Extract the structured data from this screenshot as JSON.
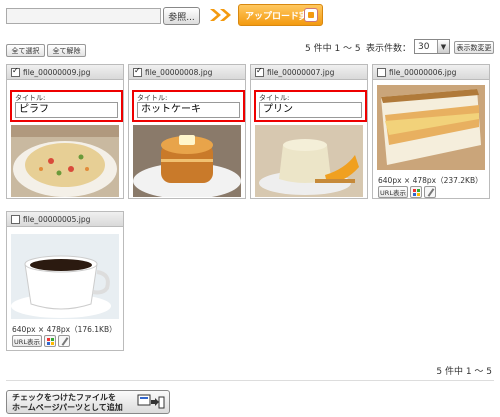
{
  "toolbar": {
    "browse_label": "参照...",
    "upload_label": "アップロード実行"
  },
  "controls": {
    "select_all": "全て選択",
    "deselect_all": "全て解除",
    "count": "5 件中 1 ～ 5",
    "perpage_label": "表示件数：",
    "perpage_value": "30",
    "perpage_button": "表示数変更"
  },
  "cards": [
    {
      "filename": "file_00000009.jpg",
      "checked": true,
      "title_label": "タイトル:",
      "title_value": "ピラフ"
    },
    {
      "filename": "file_00000008.jpg",
      "checked": true,
      "title_label": "タイトル:",
      "title_value": "ホットケーキ"
    },
    {
      "filename": "file_00000007.jpg",
      "checked": true,
      "title_label": "タイトル:",
      "title_value": "プリン"
    },
    {
      "filename": "file_00000006.jpg",
      "checked": false,
      "meta": "640px × 478px（237.2KB）",
      "url_label": "URL表示"
    },
    {
      "filename": "file_00000005.jpg",
      "checked": false,
      "meta": "640px × 478px（176.1KB）",
      "url_label": "URL表示"
    }
  ],
  "footer": {
    "count": "5 件中 1 ～ 5",
    "add_button_line1": "チェックをつけたファイルを",
    "add_button_line2": "ホームページパーツとして追加"
  },
  "colors": {
    "upload_orange": "#f39a10",
    "highlight_red": "#e00000"
  }
}
